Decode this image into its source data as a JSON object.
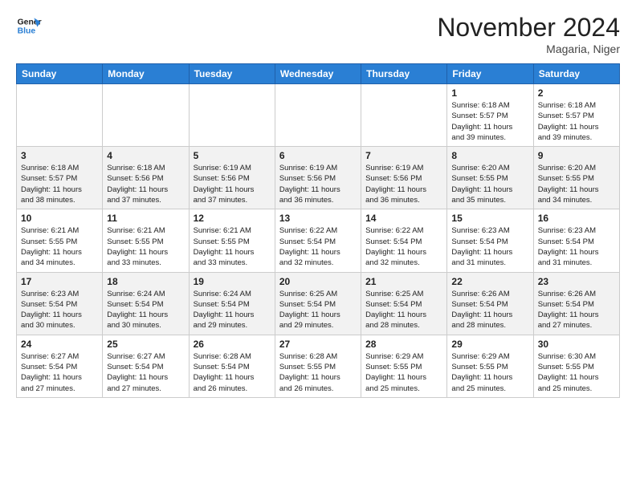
{
  "header": {
    "logo_line1": "General",
    "logo_line2": "Blue",
    "month_title": "November 2024",
    "location": "Magaria, Niger"
  },
  "weekdays": [
    "Sunday",
    "Monday",
    "Tuesday",
    "Wednesday",
    "Thursday",
    "Friday",
    "Saturday"
  ],
  "weeks": [
    [
      {
        "day": "",
        "info": ""
      },
      {
        "day": "",
        "info": ""
      },
      {
        "day": "",
        "info": ""
      },
      {
        "day": "",
        "info": ""
      },
      {
        "day": "",
        "info": ""
      },
      {
        "day": "1",
        "info": "Sunrise: 6:18 AM\nSunset: 5:57 PM\nDaylight: 11 hours\nand 39 minutes."
      },
      {
        "day": "2",
        "info": "Sunrise: 6:18 AM\nSunset: 5:57 PM\nDaylight: 11 hours\nand 39 minutes."
      }
    ],
    [
      {
        "day": "3",
        "info": "Sunrise: 6:18 AM\nSunset: 5:57 PM\nDaylight: 11 hours\nand 38 minutes."
      },
      {
        "day": "4",
        "info": "Sunrise: 6:18 AM\nSunset: 5:56 PM\nDaylight: 11 hours\nand 37 minutes."
      },
      {
        "day": "5",
        "info": "Sunrise: 6:19 AM\nSunset: 5:56 PM\nDaylight: 11 hours\nand 37 minutes."
      },
      {
        "day": "6",
        "info": "Sunrise: 6:19 AM\nSunset: 5:56 PM\nDaylight: 11 hours\nand 36 minutes."
      },
      {
        "day": "7",
        "info": "Sunrise: 6:19 AM\nSunset: 5:56 PM\nDaylight: 11 hours\nand 36 minutes."
      },
      {
        "day": "8",
        "info": "Sunrise: 6:20 AM\nSunset: 5:55 PM\nDaylight: 11 hours\nand 35 minutes."
      },
      {
        "day": "9",
        "info": "Sunrise: 6:20 AM\nSunset: 5:55 PM\nDaylight: 11 hours\nand 34 minutes."
      }
    ],
    [
      {
        "day": "10",
        "info": "Sunrise: 6:21 AM\nSunset: 5:55 PM\nDaylight: 11 hours\nand 34 minutes."
      },
      {
        "day": "11",
        "info": "Sunrise: 6:21 AM\nSunset: 5:55 PM\nDaylight: 11 hours\nand 33 minutes."
      },
      {
        "day": "12",
        "info": "Sunrise: 6:21 AM\nSunset: 5:55 PM\nDaylight: 11 hours\nand 33 minutes."
      },
      {
        "day": "13",
        "info": "Sunrise: 6:22 AM\nSunset: 5:54 PM\nDaylight: 11 hours\nand 32 minutes."
      },
      {
        "day": "14",
        "info": "Sunrise: 6:22 AM\nSunset: 5:54 PM\nDaylight: 11 hours\nand 32 minutes."
      },
      {
        "day": "15",
        "info": "Sunrise: 6:23 AM\nSunset: 5:54 PM\nDaylight: 11 hours\nand 31 minutes."
      },
      {
        "day": "16",
        "info": "Sunrise: 6:23 AM\nSunset: 5:54 PM\nDaylight: 11 hours\nand 31 minutes."
      }
    ],
    [
      {
        "day": "17",
        "info": "Sunrise: 6:23 AM\nSunset: 5:54 PM\nDaylight: 11 hours\nand 30 minutes."
      },
      {
        "day": "18",
        "info": "Sunrise: 6:24 AM\nSunset: 5:54 PM\nDaylight: 11 hours\nand 30 minutes."
      },
      {
        "day": "19",
        "info": "Sunrise: 6:24 AM\nSunset: 5:54 PM\nDaylight: 11 hours\nand 29 minutes."
      },
      {
        "day": "20",
        "info": "Sunrise: 6:25 AM\nSunset: 5:54 PM\nDaylight: 11 hours\nand 29 minutes."
      },
      {
        "day": "21",
        "info": "Sunrise: 6:25 AM\nSunset: 5:54 PM\nDaylight: 11 hours\nand 28 minutes."
      },
      {
        "day": "22",
        "info": "Sunrise: 6:26 AM\nSunset: 5:54 PM\nDaylight: 11 hours\nand 28 minutes."
      },
      {
        "day": "23",
        "info": "Sunrise: 6:26 AM\nSunset: 5:54 PM\nDaylight: 11 hours\nand 27 minutes."
      }
    ],
    [
      {
        "day": "24",
        "info": "Sunrise: 6:27 AM\nSunset: 5:54 PM\nDaylight: 11 hours\nand 27 minutes."
      },
      {
        "day": "25",
        "info": "Sunrise: 6:27 AM\nSunset: 5:54 PM\nDaylight: 11 hours\nand 27 minutes."
      },
      {
        "day": "26",
        "info": "Sunrise: 6:28 AM\nSunset: 5:54 PM\nDaylight: 11 hours\nand 26 minutes."
      },
      {
        "day": "27",
        "info": "Sunrise: 6:28 AM\nSunset: 5:55 PM\nDaylight: 11 hours\nand 26 minutes."
      },
      {
        "day": "28",
        "info": "Sunrise: 6:29 AM\nSunset: 5:55 PM\nDaylight: 11 hours\nand 25 minutes."
      },
      {
        "day": "29",
        "info": "Sunrise: 6:29 AM\nSunset: 5:55 PM\nDaylight: 11 hours\nand 25 minutes."
      },
      {
        "day": "30",
        "info": "Sunrise: 6:30 AM\nSunset: 5:55 PM\nDaylight: 11 hours\nand 25 minutes."
      }
    ]
  ]
}
